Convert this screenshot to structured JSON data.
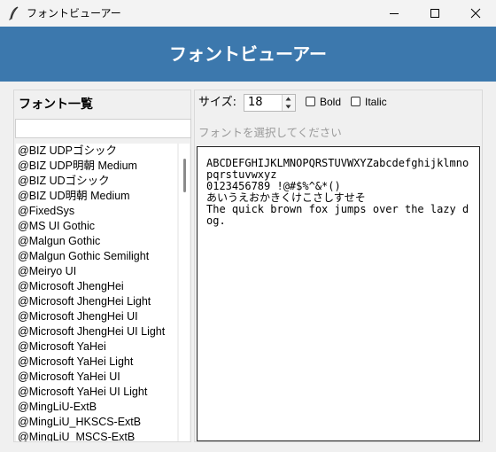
{
  "window": {
    "title": "フォントビューアー"
  },
  "header": {
    "title": "フォントビューアー"
  },
  "left_panel": {
    "title": "フォント一覧",
    "search_value": "",
    "fonts": [
      "@BIZ UDPゴシック",
      "@BIZ UDP明朝 Medium",
      "@BIZ UDゴシック",
      "@BIZ UD明朝 Medium",
      "@FixedSys",
      "@MS UI Gothic",
      "@Malgun Gothic",
      "@Malgun Gothic Semilight",
      "@Meiryo UI",
      "@Microsoft JhengHei",
      "@Microsoft JhengHei Light",
      "@Microsoft JhengHei UI",
      "@Microsoft JhengHei UI Light",
      "@Microsoft YaHei",
      "@Microsoft YaHei Light",
      "@Microsoft YaHei UI",
      "@Microsoft YaHei UI Light",
      "@MingLiU-ExtB",
      "@MingLiU_HKSCS-ExtB",
      "@MingLiU_MSCS-ExtB"
    ]
  },
  "toolbar": {
    "size_label": "サイズ:",
    "size_value": "18",
    "bold_label": "Bold",
    "bold_checked": false,
    "italic_label": "Italic",
    "italic_checked": false
  },
  "hint": "フォントを選択してください",
  "preview": {
    "lines": [
      "ABCDEFGHIJKLMNOPQRSTUVWXYZabcdefghijklmnopqrstuvwxyz",
      "0123456789 !@#$%^&*()",
      "あいうえおかきくけこさしすせそ",
      "The quick brown fox jumps over the lazy dog."
    ]
  },
  "colors": {
    "header_bg": "#3c78ad",
    "header_text": "#ffffff",
    "hint_text": "#9a9a9a"
  },
  "icons": {
    "app": "feather-icon",
    "minimize": "minimize-icon",
    "maximize": "maximize-icon",
    "close": "close-icon"
  }
}
